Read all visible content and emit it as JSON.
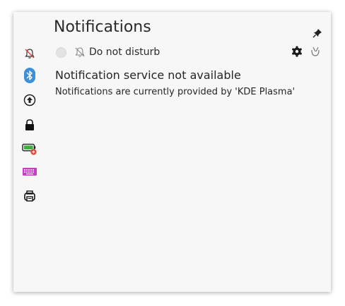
{
  "header": {
    "title": "Notifications"
  },
  "dnd": {
    "label": "Do not disturb",
    "checked": false
  },
  "message": {
    "title": "Notification service not available",
    "body": "Notifications are currently provided by 'KDE Plasma'"
  },
  "sidebar": {
    "icons": [
      "notifications-disabled-icon",
      "bluetooth-icon",
      "updates-icon",
      "lock-icon",
      "battery-icon",
      "keyboard-icon",
      "printer-icon"
    ]
  },
  "colors": {
    "bluetooth": "#3d8fd8",
    "battery_fill": "#3fae3f",
    "battery_badge": "#e0453a",
    "keyboard": "#c63dc9"
  }
}
